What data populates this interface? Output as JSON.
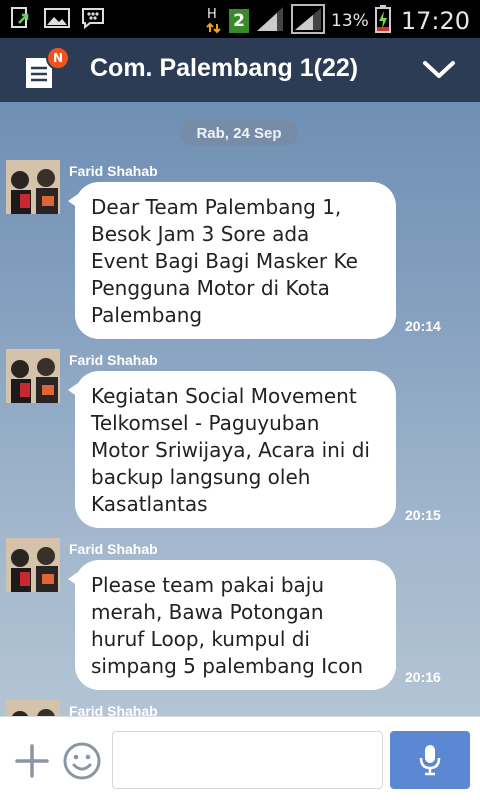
{
  "status_bar": {
    "battery_percent": "13%",
    "time": "17:20",
    "network_type": "H",
    "sim_badge": "2",
    "icons": [
      "screenshot-icon",
      "gallery-icon",
      "bbm-icon",
      "network-h-icon",
      "sim2-icon",
      "signal-icon",
      "signal-icon",
      "battery-charging-icon"
    ]
  },
  "header": {
    "notes_badge": "N",
    "title": "Com. Palembang 1(22)",
    "icons": [
      "notes-icon",
      "chevron-down-icon"
    ]
  },
  "chat": {
    "date_label": "Rab, 24 Sep",
    "messages": [
      {
        "sender": "Farid Shahab",
        "text": "Dear Team Palembang 1,\nBesok Jam 3 Sore ada\nEvent Bagi Bagi Masker Ke\nPengguna Motor di Kota\nPalembang",
        "time": "20:14"
      },
      {
        "sender": "Farid Shahab",
        "text": "Kegiatan Social Movement\nTelkomsel - Paguyuban\nMotor Sriwijaya, Acara ini di\nbackup langsung oleh\nKasatlantas",
        "time": "20:15"
      },
      {
        "sender": "Farid Shahab",
        "text": "Please team pakai baju\nmerah, Bawa Potongan\nhuruf Loop, kumpul di\nsimpang 5 palembang Icon",
        "time": "20:16"
      },
      {
        "sender": "Farid Shahab",
        "text": "",
        "time": ""
      }
    ]
  },
  "input_bar": {
    "value": "",
    "placeholder": "",
    "icons": [
      "plus-icon",
      "emoji-icon",
      "microphone-icon"
    ]
  },
  "colors": {
    "header_bg": "#2d3c55",
    "badge": "#f0531c",
    "mic_button": "#5b87d3",
    "bubble": "#ffffff"
  }
}
